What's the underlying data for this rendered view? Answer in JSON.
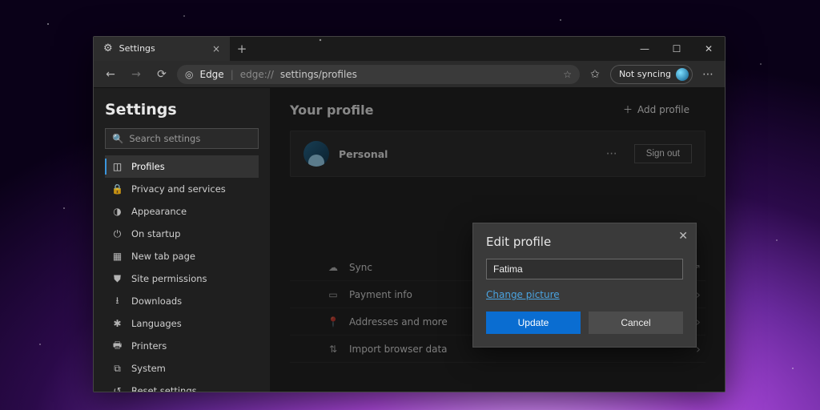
{
  "window": {
    "tab_title": "Settings",
    "minimize": "—",
    "maximize": "☐",
    "close": "✕"
  },
  "address_bar": {
    "brand": "Edge",
    "separator": "|",
    "url": "edge://settings/profiles",
    "url_scheme": "edge://",
    "url_path": "settings/profiles",
    "sync_label": "Not syncing"
  },
  "sidebar": {
    "title": "Settings",
    "search_placeholder": "Search settings",
    "items": [
      {
        "icon": "◫",
        "label": "Profiles",
        "active": true
      },
      {
        "icon": "🔒",
        "label": "Privacy and services"
      },
      {
        "icon": "◑",
        "label": "Appearance"
      },
      {
        "icon": "⏻",
        "label": "On startup"
      },
      {
        "icon": "▦",
        "label": "New tab page"
      },
      {
        "icon": "⛊",
        "label": "Site permissions"
      },
      {
        "icon": "⭳",
        "label": "Downloads"
      },
      {
        "icon": "✱",
        "label": "Languages"
      },
      {
        "icon": "🖶",
        "label": "Printers"
      },
      {
        "icon": "⧉",
        "label": "System"
      },
      {
        "icon": "↺",
        "label": "Reset settings"
      }
    ]
  },
  "main": {
    "heading": "Your profile",
    "add_profile": "Add profile",
    "profile_name": "Personal",
    "sign_out": "Sign out",
    "rows": [
      {
        "icon": "☁",
        "label": "Sync",
        "kind": "external"
      },
      {
        "icon": "▭",
        "label": "Payment info",
        "kind": "chevron"
      },
      {
        "icon": "📍",
        "label": "Addresses and more",
        "kind": "chevron"
      },
      {
        "icon": "⇅",
        "label": "Import browser data",
        "kind": "chevron"
      }
    ]
  },
  "modal": {
    "title": "Edit profile",
    "input_value": "Fatima",
    "change_picture": "Change picture",
    "update": "Update",
    "cancel": "Cancel"
  }
}
